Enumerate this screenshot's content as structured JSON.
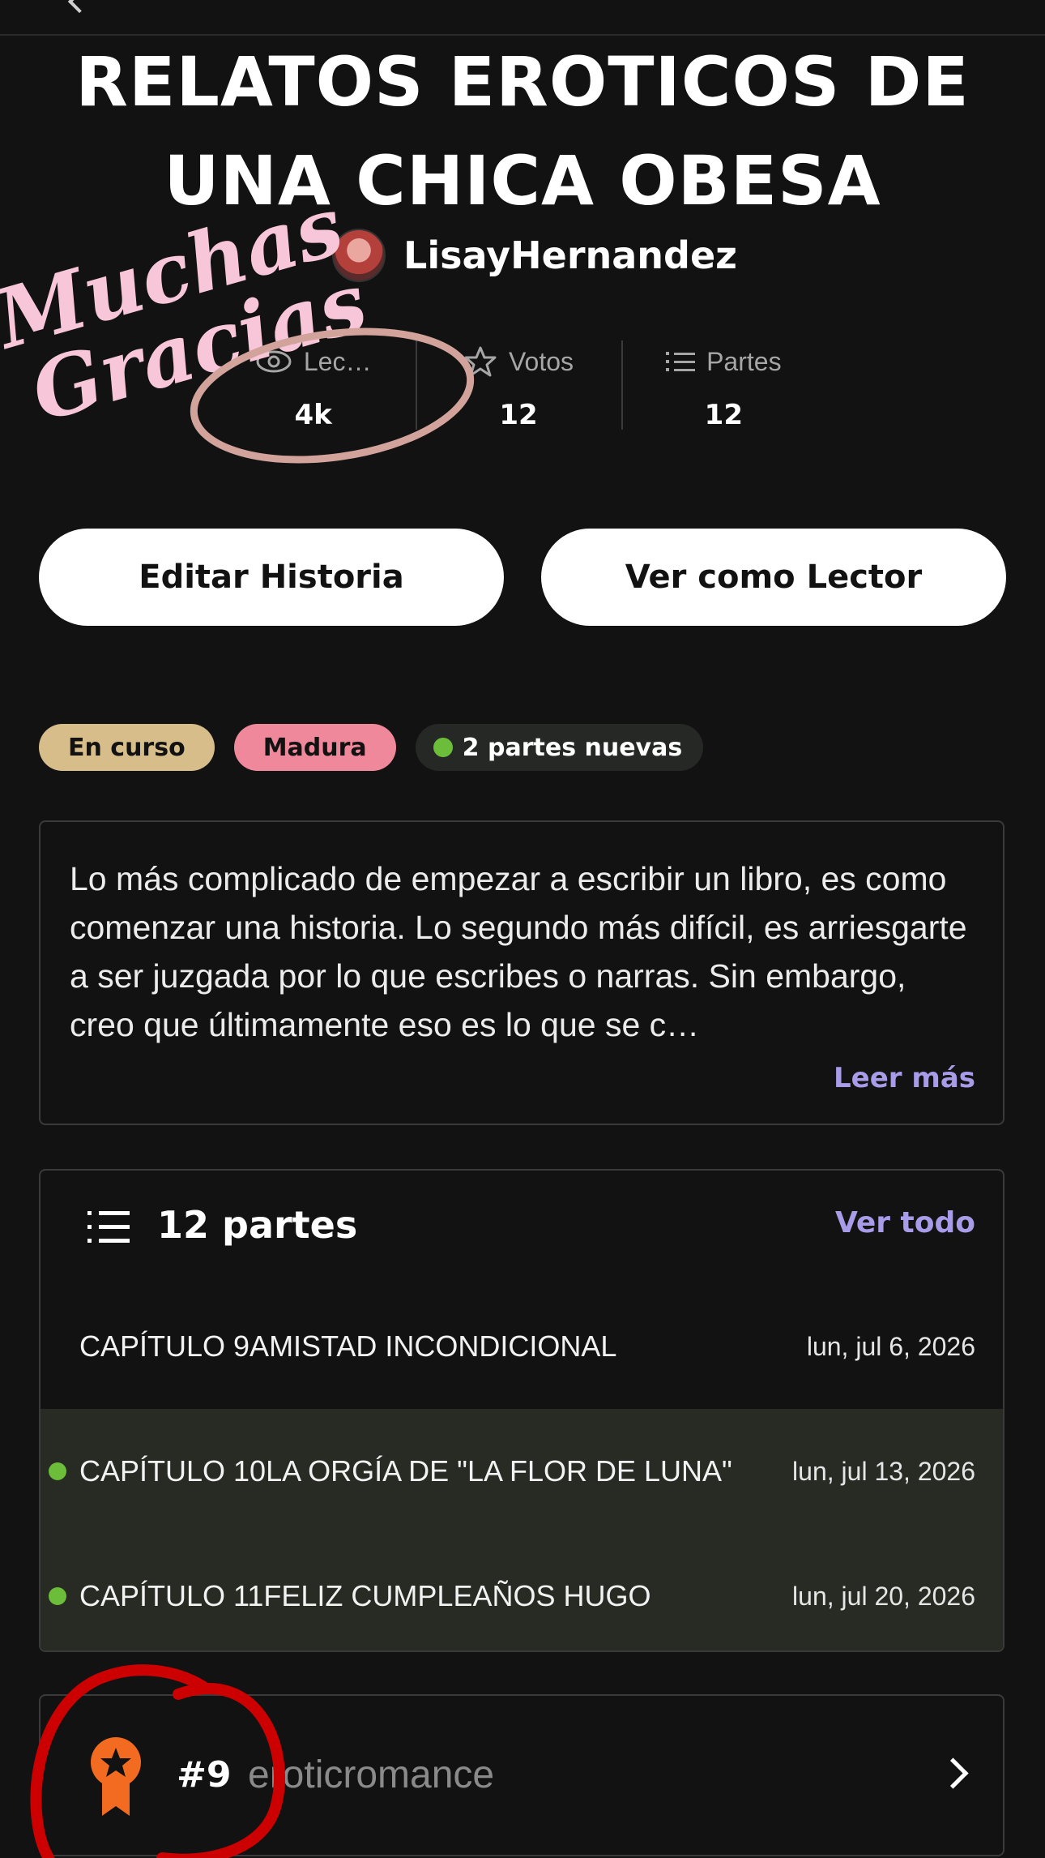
{
  "story": {
    "title": "RELATOS EROTICOS DE UNA CHICA OBESA",
    "author": "LisayHernandez"
  },
  "stats": [
    {
      "label": "Lec…",
      "value": "4k",
      "icon": "eye-icon"
    },
    {
      "label": "Votos",
      "value": "12",
      "icon": "star-icon"
    },
    {
      "label": "Partes",
      "value": "12",
      "icon": "list-icon"
    }
  ],
  "actions": {
    "edit_label": "Editar Historia",
    "reader_label": "Ver como Lector"
  },
  "tags": {
    "status": "En curso",
    "rating": "Madura",
    "new_parts": "2 partes nuevas"
  },
  "description": {
    "text": "Lo más complicado de empezar a escribir un libro, es como comenzar una historia. Lo segundo más difícil, es arriesgarte a ser juzgada por lo que escribes o narras. Sin embargo, creo que últimamente eso es lo que se c…",
    "read_more": "Leer más"
  },
  "parts": {
    "title": "12 partes",
    "see_all": "Ver todo",
    "items": [
      {
        "title": "CAPÍTULO 9AMISTAD INCONDICIONAL",
        "date": "lun, jul 6, 2026",
        "new": false
      },
      {
        "title": "CAPÍTULO 10LA ORGÍA DE \"LA FLOR DE LUNA\"",
        "date": "lun, jul 13, 2026",
        "new": true
      },
      {
        "title": "CAPÍTULO 11FELIZ CUMPLEAÑOS HUGO",
        "date": "lun, jul 20, 2026",
        "new": true
      }
    ]
  },
  "ranking": {
    "rank": "#9",
    "tag": "eroticromance"
  },
  "annotation": {
    "line1": "Muchas",
    "line2": "Gracias"
  },
  "colors": {
    "background": "#121212",
    "accent": "#a89be8",
    "status_tag": "#d6bd8a",
    "rating_tag": "#f0889b",
    "new_dot": "#6bbd3a",
    "rank_badge": "#f36b21",
    "annotation_pink": "#f7c6d8",
    "annotation_red": "#cc0000"
  }
}
